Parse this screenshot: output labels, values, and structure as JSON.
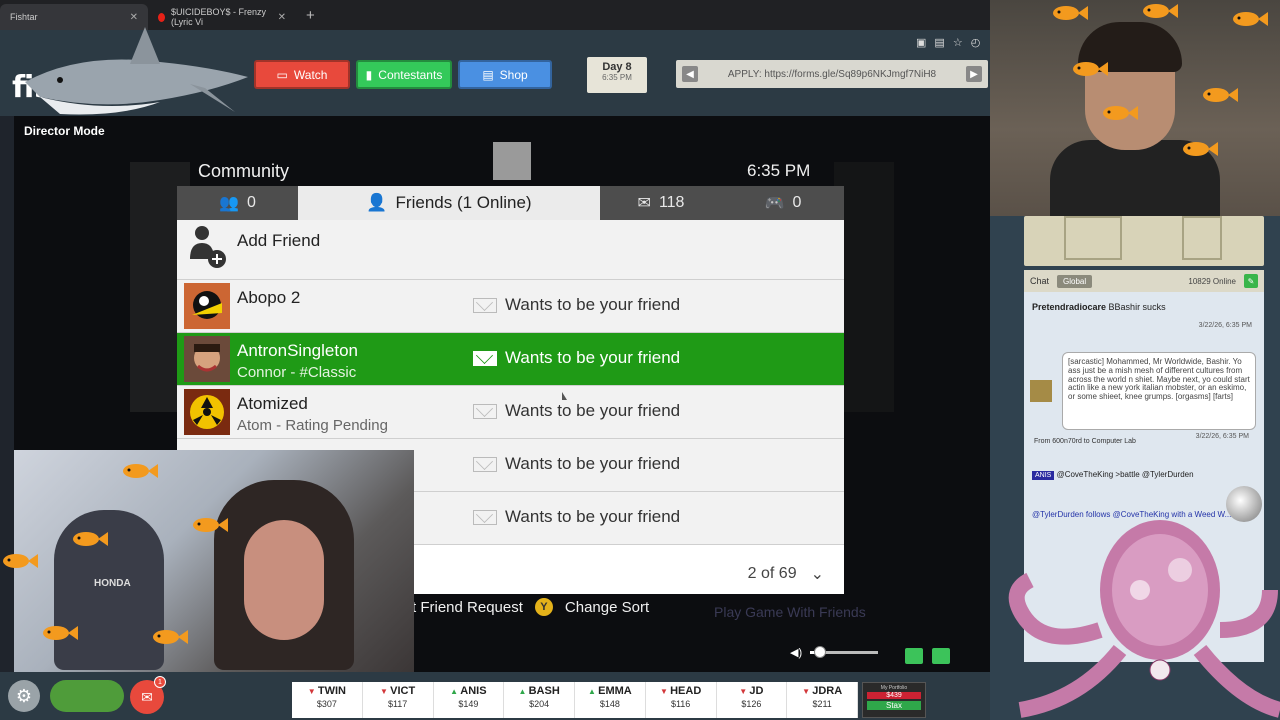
{
  "browser": {
    "tabs": [
      {
        "label": "Fishtar",
        "active": true
      },
      {
        "label": "$UICIDEBOY$ - Frenzy (Lyric Vi",
        "active": false
      }
    ],
    "new_tab": "+"
  },
  "site": {
    "logo": "fis",
    "buttons": {
      "watch": "Watch",
      "contestants": "Contestants",
      "shop": "Shop"
    },
    "day": {
      "label": "Day 8",
      "time": "6:35 PM"
    },
    "apply": "APPLY: https://forms.gle/Sq89p6NKJmgf7NiH8"
  },
  "video": {
    "director_mode": "Director Mode",
    "header": {
      "title": "Community",
      "clock": "6:35 PM"
    },
    "tabs": [
      {
        "label": "0",
        "icon": "group-icon"
      },
      {
        "label": "Friends (1 Online)",
        "icon": "friend-icon"
      },
      {
        "label": "118",
        "icon": "mail-icon"
      },
      {
        "label": "0",
        "icon": "controller-icon"
      }
    ],
    "add_friend": "Add Friend",
    "friends": [
      {
        "name": "Abopo 2",
        "sub": "",
        "request": "Wants to be your friend",
        "highlighted": false
      },
      {
        "name": "AntronSingleton",
        "sub": "Connor - #Classic",
        "request": "Wants to be your friend",
        "highlighted": true
      },
      {
        "name": "Atomized",
        "sub": "Atom - Rating Pending",
        "request": "Wants to be your friend",
        "highlighted": false
      },
      {
        "name": "",
        "sub": "",
        "request": "Wants to be your friend",
        "highlighted": false
      },
      {
        "name": "",
        "sub": "",
        "request": "Wants to be your friend",
        "highlighted": false
      }
    ],
    "pager": "2 of 69",
    "footer": {
      "friend_request": "t Friend Request",
      "y_button": "Y",
      "change_sort": "Change Sort",
      "ghost": "Play Game With Friends"
    }
  },
  "cam1": {
    "shirt_text": "HONDA"
  },
  "chat": {
    "tab": "Chat",
    "global": "Global",
    "online": "10829 Online",
    "messages": {
      "m1_user": "Pretendradiocare",
      "m1_text": "BBashir sucks",
      "m1_time": "3/22/26, 6:35 PM",
      "bubble": "[sarcastic] Mohammed, Mr Worldwide, Bashir. Yo ass just be a mish mesh of different cultures from across the world n shiet. Maybe next, yo could start actin like a new york italian mobster, or an eskimo, or some shieet, knee grumps. [orgasms] [farts]",
      "bubble_time": "3/22/26, 6:35 PM",
      "from": "From 600n70rd to Computer Lab",
      "m3_user": "ANIS",
      "m3_text": "@CoveTheKing >battle @TylerDurden",
      "m4_text": "@TylerDurden follows @CoveTheKing with a Weed W..."
    }
  },
  "ticker": [
    {
      "sym": "TWIN",
      "dir": "down",
      "val": "$307"
    },
    {
      "sym": "VICT",
      "dir": "down",
      "val": "$117"
    },
    {
      "sym": "ANIS",
      "dir": "up",
      "val": "$149"
    },
    {
      "sym": "BASH",
      "dir": "up",
      "val": "$204"
    },
    {
      "sym": "EMMA",
      "dir": "up",
      "val": "$148"
    },
    {
      "sym": "HEAD",
      "dir": "down",
      "val": "$116"
    },
    {
      "sym": "JD",
      "dir": "down",
      "val": "$126"
    },
    {
      "sym": "JDRA",
      "dir": "down",
      "val": "$211"
    }
  ],
  "portfolio": {
    "label": "My Portfolio",
    "value": "$439",
    "button": "Stax"
  },
  "badges": {
    "notif": "1"
  },
  "volume": {
    "level": 0.15
  },
  "colors": {
    "highlight": "#1f9a16",
    "watch": "#e8493c",
    "contestants": "#34c95a",
    "shop": "#4a90e2"
  }
}
